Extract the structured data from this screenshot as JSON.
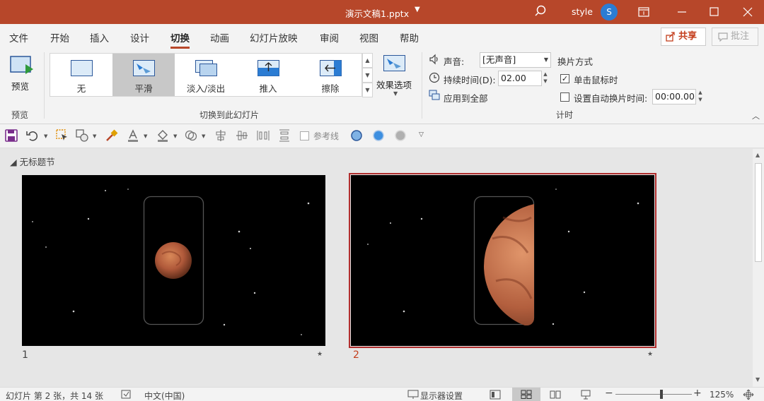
{
  "titlebar": {
    "document": "演示文稿1.pptx",
    "user": "style",
    "avatar_initial": "S"
  },
  "tabs": [
    "文件",
    "开始",
    "插入",
    "设计",
    "切换",
    "动画",
    "幻灯片放映",
    "审阅",
    "视图",
    "帮助"
  ],
  "active_tab": "切换",
  "share_label": "共享",
  "comment_label": "批注",
  "ribbon": {
    "preview": {
      "button": "预览",
      "group": "预览"
    },
    "transitions": {
      "items": [
        {
          "label": "无",
          "icon": "none-transition-icon"
        },
        {
          "label": "平滑",
          "icon": "morph-transition-icon",
          "selected": true
        },
        {
          "label": "淡入/淡出",
          "icon": "fade-transition-icon"
        },
        {
          "label": "推入",
          "icon": "push-transition-icon"
        },
        {
          "label": "擦除",
          "icon": "wipe-transition-icon"
        }
      ],
      "effect_options": "效果选项",
      "group": "切换到此幻灯片"
    },
    "timing": {
      "sound_label": "声音:",
      "sound_value": "[无声音]",
      "duration_label": "持续时间(D):",
      "duration_value": "02.00",
      "apply_all": "应用到全部",
      "advance_title": "换片方式",
      "on_click": "单击鼠标时",
      "on_click_checked": true,
      "after_time": "设置自动换片时间:",
      "after_time_checked": false,
      "after_time_value": "00:00.00",
      "group": "计时"
    }
  },
  "qat": {
    "guides_label": "参考线"
  },
  "section": "无标题节",
  "slides": [
    {
      "number": "1",
      "selected": false
    },
    {
      "number": "2",
      "selected": true
    }
  ],
  "status": {
    "slide_info": "幻灯片 第 2 张，共 14 张",
    "language": "中文(中国)",
    "display_settings": "显示器设置",
    "zoom": "125%"
  },
  "colors": {
    "accent": "#b7472a",
    "selected_slide_border": "#b02e2e",
    "selected_slide_number": "#c43e1c"
  }
}
